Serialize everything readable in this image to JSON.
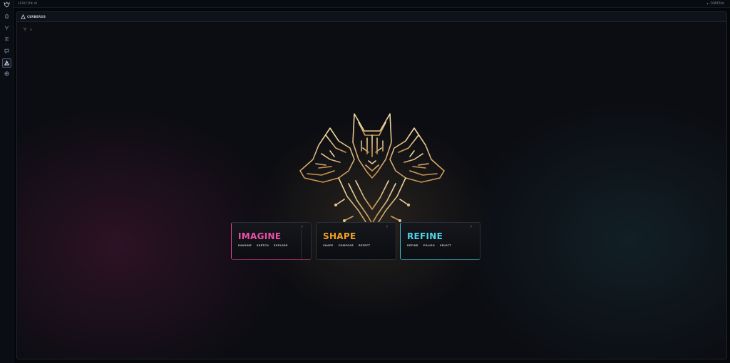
{
  "topbar": {
    "title": "LEXICON AI",
    "right_label": "CONTROL"
  },
  "rail": {
    "items": [
      {
        "name": "home-icon"
      },
      {
        "name": "branch-icon"
      },
      {
        "name": "nodes-icon"
      },
      {
        "name": "chat-icon"
      },
      {
        "name": "triangle-icon",
        "active": true
      },
      {
        "name": "globe-icon"
      }
    ]
  },
  "panel": {
    "title": "CERBERUS",
    "breadcrumb": "A"
  },
  "cards": [
    {
      "title": "IMAGINE",
      "tags": [
        "IMAGINE",
        "SKETCH",
        "EXPLORE"
      ],
      "accent": "#ee4fa9"
    },
    {
      "title": "SHAPE",
      "tags": [
        "SHAPE",
        "COMPOSE",
        "REFECT"
      ],
      "accent": "#f3a323"
    },
    {
      "title": "REFINE",
      "tags": [
        "REFINE",
        "POLISH",
        "SELECT"
      ],
      "accent": "#4fd4ea"
    }
  ]
}
